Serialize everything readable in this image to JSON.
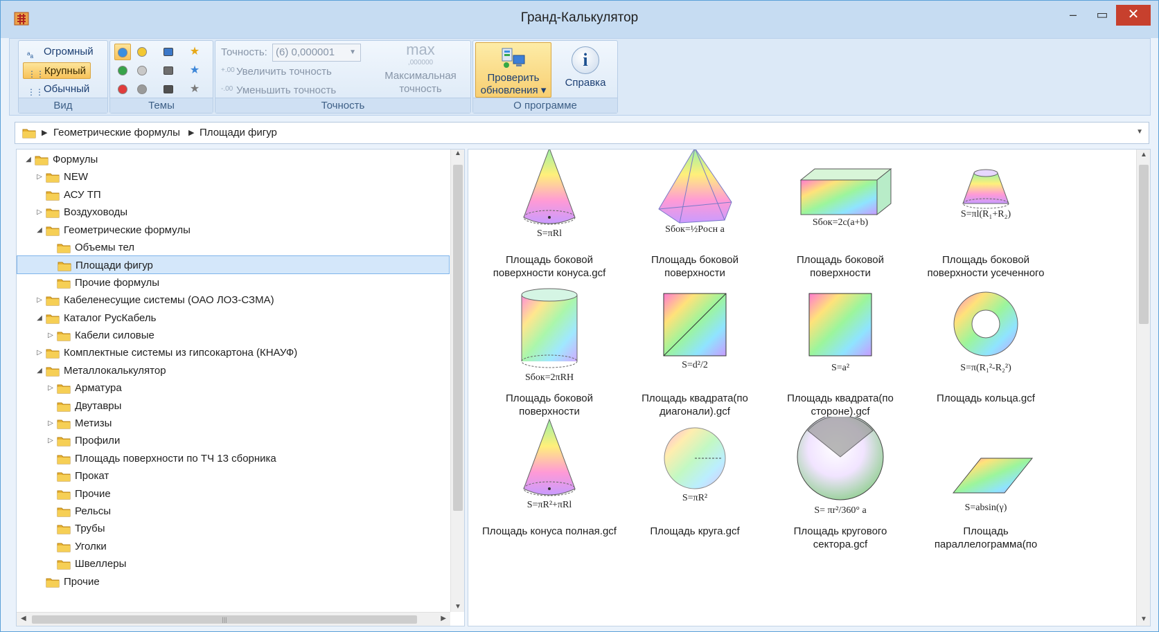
{
  "window": {
    "title": "Гранд-Калькулятор",
    "min_glyph": "–",
    "max_glyph": "▭",
    "close_glyph": "✕"
  },
  "ribbon": {
    "view": {
      "label": "Вид",
      "items": [
        "Огромный",
        "Крупный",
        "Обычный"
      ],
      "active": "Крупный"
    },
    "themes": {
      "label": "Темы"
    },
    "precision": {
      "label": "Точность",
      "field_label": "Точность:",
      "value": "(6)  0,000001",
      "increase": "Увеличить точность",
      "decrease": "Уменьшить точность",
      "max_icon": "max",
      "max_sub": ",000000",
      "max_label_1": "Максимальная",
      "max_label_2": "точность"
    },
    "about": {
      "label": "О программе",
      "update_1": "Проверить",
      "update_2": "обновления ▾",
      "help": "Справка",
      "help_icon": "i"
    }
  },
  "address": {
    "crumbs": [
      "Геометрические формулы",
      "Площади фигур"
    ]
  },
  "tree": [
    {
      "label": "Формулы",
      "level": 0,
      "exp": "◢"
    },
    {
      "label": "NEW",
      "level": 1,
      "exp": "▷"
    },
    {
      "label": "АСУ ТП",
      "level": 1,
      "exp": ""
    },
    {
      "label": "Воздуховоды",
      "level": 1,
      "exp": "▷"
    },
    {
      "label": "Геометрические формулы",
      "level": 1,
      "exp": "◢"
    },
    {
      "label": "Объемы тел",
      "level": 2,
      "exp": ""
    },
    {
      "label": "Площади фигур",
      "level": 2,
      "exp": "",
      "selected": true
    },
    {
      "label": "Прочие формулы",
      "level": 2,
      "exp": ""
    },
    {
      "label": "Кабеленесущие системы (ОАО ЛОЗ-СЗМА)",
      "level": 1,
      "exp": "▷"
    },
    {
      "label": "Каталог РусКабель",
      "level": 1,
      "exp": "◢"
    },
    {
      "label": "Кабели силовые",
      "level": 2,
      "exp": "▷"
    },
    {
      "label": "Комплектные системы из гипсокартона (КНАУФ)",
      "level": 1,
      "exp": "▷"
    },
    {
      "label": "Металлокалькулятор",
      "level": 1,
      "exp": "◢"
    },
    {
      "label": "Арматура",
      "level": 2,
      "exp": "▷"
    },
    {
      "label": "Двутавры",
      "level": 2,
      "exp": ""
    },
    {
      "label": "Метизы",
      "level": 2,
      "exp": "▷"
    },
    {
      "label": "Профили",
      "level": 2,
      "exp": "▷"
    },
    {
      "label": "Площадь поверхности по ТЧ 13 сборника",
      "level": 2,
      "exp": ""
    },
    {
      "label": "Прокат",
      "level": 2,
      "exp": ""
    },
    {
      "label": "Прочие",
      "level": 2,
      "exp": ""
    },
    {
      "label": "Рельсы",
      "level": 2,
      "exp": ""
    },
    {
      "label": "Трубы",
      "level": 2,
      "exp": ""
    },
    {
      "label": "Уголки",
      "level": 2,
      "exp": ""
    },
    {
      "label": "Швеллеры",
      "level": 2,
      "exp": ""
    },
    {
      "label": "Прочие",
      "level": 1,
      "exp": ""
    }
  ],
  "items": [
    {
      "label": "Площадь боковой поверхности конуса.gcf",
      "formula": "S=πRl",
      "shape": "cone"
    },
    {
      "label": "Площадь боковой поверхности",
      "formula": "Sбок=½Pосн a",
      "shape": "pyramid"
    },
    {
      "label": "Площадь боковой поверхности",
      "formula": "Sбок=2c(a+b)",
      "shape": "box"
    },
    {
      "label": "Площадь боковой поверхности усеченного",
      "formula": "S=πl(R₁+R₂)",
      "shape": "frustum"
    },
    {
      "label": "Площадь боковой поверхности",
      "formula": "Sбок=2πRH",
      "shape": "cylinder"
    },
    {
      "label": "Площадь квадрата(по диагонали).gcf",
      "formula": "S=d²/2",
      "shape": "square-diag"
    },
    {
      "label": "Площадь квадрата(по стороне).gcf",
      "formula": "S=a²",
      "shape": "square"
    },
    {
      "label": "Площадь кольца.gcf",
      "formula": "S=π(R₁²-R₂²)",
      "shape": "ring"
    },
    {
      "label": "Площадь конуса полная.gcf",
      "formula": "S=πR²+πRl",
      "shape": "cone"
    },
    {
      "label": "Площадь круга.gcf",
      "formula": "S=πR²",
      "shape": "circle"
    },
    {
      "label": "Площадь кругового сектора.gcf",
      "formula": "S= πr²/360° a",
      "shape": "sector"
    },
    {
      "label": "Площадь параллелограмма(по",
      "formula": "S=absin(γ)",
      "shape": "parallelogram"
    }
  ]
}
